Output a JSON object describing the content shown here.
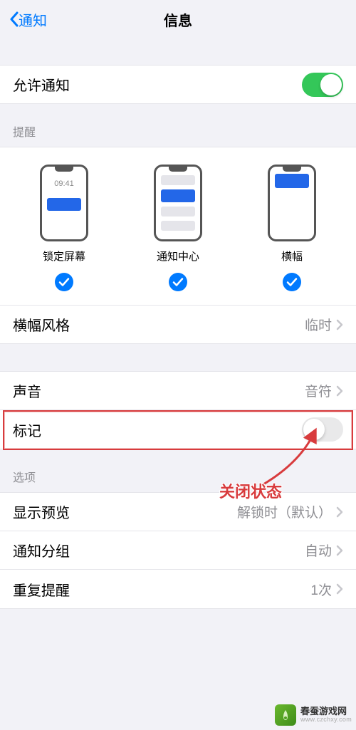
{
  "nav": {
    "back": "通知",
    "title": "信息"
  },
  "allow": {
    "label": "允许通知",
    "on": true
  },
  "alerts": {
    "header": "提醒",
    "lock_time": "09:41",
    "lock_label": "锁定屏幕",
    "nc_label": "通知中心",
    "banner_label": "横幅"
  },
  "bannerStyle": {
    "label": "横幅风格",
    "value": "临时"
  },
  "sound": {
    "label": "声音",
    "value": "音符"
  },
  "badge": {
    "label": "标记",
    "on": false
  },
  "options": {
    "header": "选项",
    "preview": {
      "label": "显示预览",
      "value": "解锁时（默认）"
    },
    "grouping": {
      "label": "通知分组",
      "value": "自动"
    },
    "repeat": {
      "label": "重复提醒",
      "value": "1次"
    }
  },
  "annotation": {
    "text": "关闭状态"
  },
  "watermark": {
    "line1": "春蚕游戏网",
    "line2": "www.czchxy.com"
  }
}
